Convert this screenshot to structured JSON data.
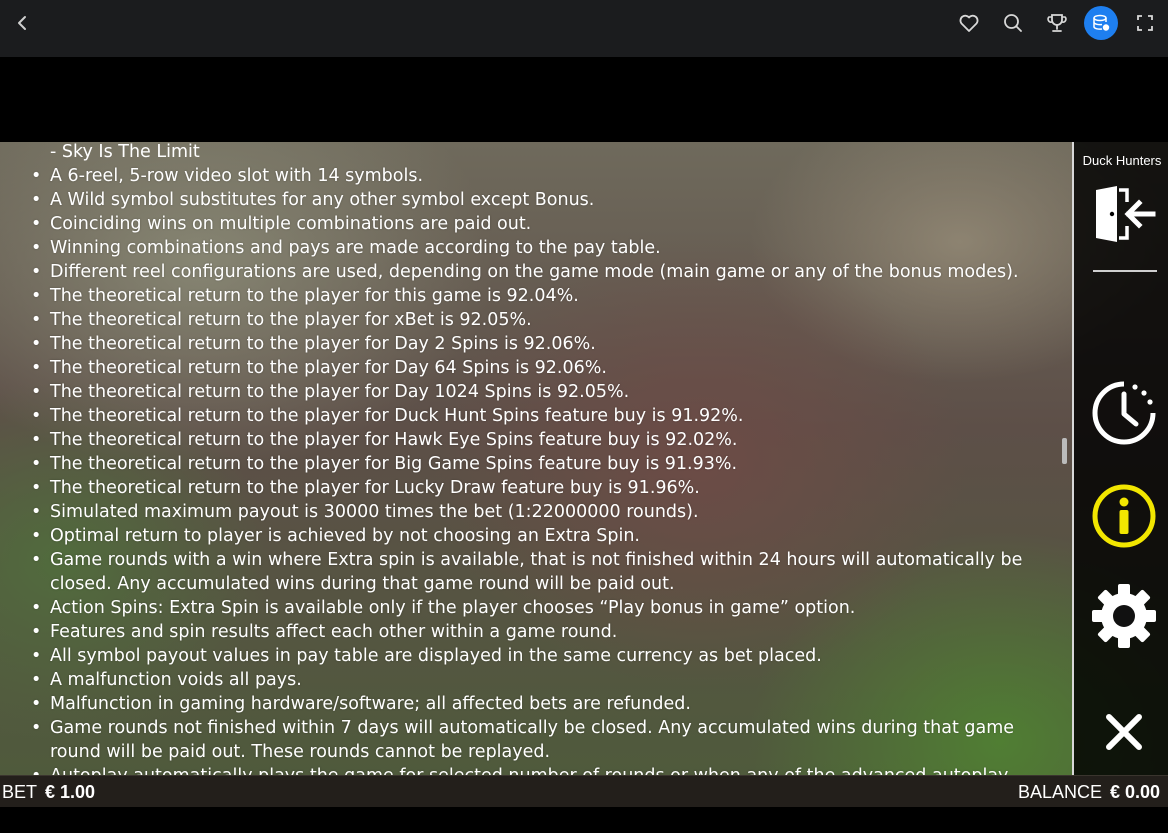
{
  "topbar": {
    "icons": [
      "back-icon",
      "heart-icon",
      "search-icon",
      "trophy-icon",
      "coins-icon",
      "fullscreen-icon"
    ],
    "accent_color": "#1e7ff0"
  },
  "rules": {
    "intro_line": "- Sky Is The Limit",
    "items": [
      "A 6-reel, 5-row video slot with 14 symbols.",
      "A Wild symbol substitutes for any other symbol except Bonus.",
      "Coinciding wins on multiple combinations are paid out.",
      "Winning combinations and pays are made according to the pay table.",
      "Different reel configurations are used, depending on the game mode (main game or any of the bonus modes).",
      "The theoretical return to the player for this game is 92.04%.",
      "The theoretical return to the player for xBet is 92.05%.",
      "The theoretical return to the player for Day 2 Spins is 92.06%.",
      "The theoretical return to the player for Day 64 Spins is 92.06%.",
      "The theoretical return to the player for Day 1024 Spins is 92.05%.",
      "The theoretical return to the player for Duck Hunt Spins feature buy is 91.92%.",
      "The theoretical return to the player for Hawk Eye Spins feature buy is 92.02%.",
      "The theoretical return to the player for Big Game Spins feature buy is 91.93%.",
      "The theoretical return to the player for Lucky Draw feature buy is 91.96%.",
      "Simulated maximum payout is 30000 times the bet (1:22000000 rounds).",
      "Optimal return to player is achieved by not choosing an Extra Spin.",
      "Game rounds with a win where Extra spin is available, that is not finished within 24 hours will automatically be closed. Any accumulated wins during that game round will be paid out.",
      "Action Spins: Extra Spin is available only if the player chooses “Play bonus in game” option.",
      "Features and spin results affect each other within a game round.",
      "All symbol payout values in pay table are displayed in the same currency as bet placed.",
      "A malfunction voids all pays.",
      "Malfunction in gaming hardware/software; all affected bets are refunded.",
      "Game rounds not finished within 7 days will automatically be closed. Any accumulated wins during that game round will be paid out. These rounds cannot be replayed.",
      "Autoplay automatically plays the game for selected number of rounds or when any of the advanced autoplay setting"
    ]
  },
  "side_panel": {
    "game_name": "Duck Hunters",
    "icons": [
      "exit-icon",
      "history-icon",
      "info-icon",
      "settings-icon",
      "close-icon"
    ],
    "info_color": "#f2e600"
  },
  "status": {
    "bet_label": "BET",
    "bet_value": "€ 1.00",
    "balance_label": "BALANCE",
    "balance_value": "€ 0.00"
  }
}
